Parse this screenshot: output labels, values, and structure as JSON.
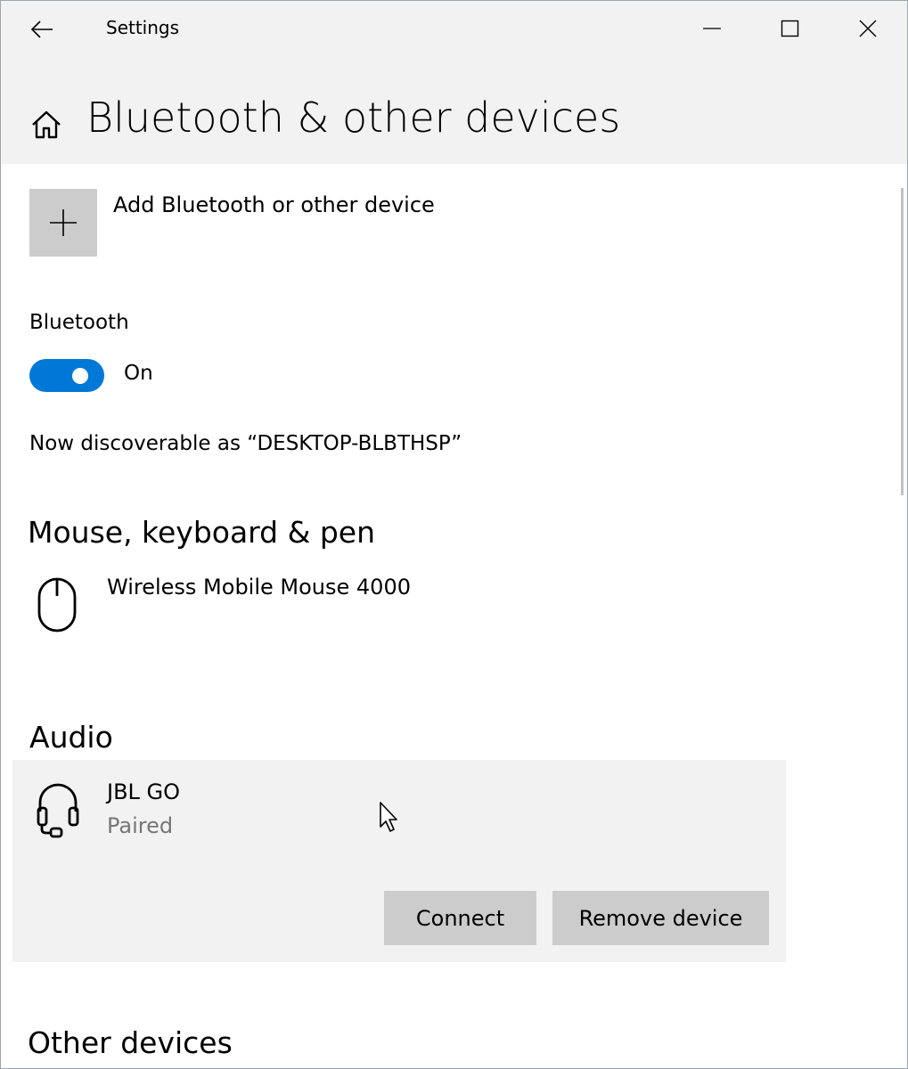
{
  "window": {
    "title": "Settings"
  },
  "header": {
    "title": "Bluetooth & other devices"
  },
  "add_device": {
    "label": "Add Bluetooth or other device"
  },
  "bluetooth": {
    "label": "Bluetooth",
    "state": "On",
    "discoverable_text": "Now discoverable as “DESKTOP-BLBTHSP”"
  },
  "sections": {
    "mouse_keyboard_pen": {
      "heading": "Mouse, keyboard & pen",
      "devices": [
        {
          "name": "Wireless Mobile Mouse 4000",
          "icon": "mouse-icon"
        }
      ]
    },
    "audio": {
      "heading": "Audio",
      "devices": [
        {
          "name": "JBL GO",
          "status": "Paired",
          "icon": "headset-icon"
        }
      ],
      "buttons": {
        "connect": "Connect",
        "remove": "Remove device"
      }
    },
    "other_devices": {
      "heading": "Other devices"
    }
  },
  "colors": {
    "accent": "#0078d7",
    "header_bg": "#f2f2f2",
    "button_bg": "#cccccc",
    "secondary_text": "#767676"
  }
}
